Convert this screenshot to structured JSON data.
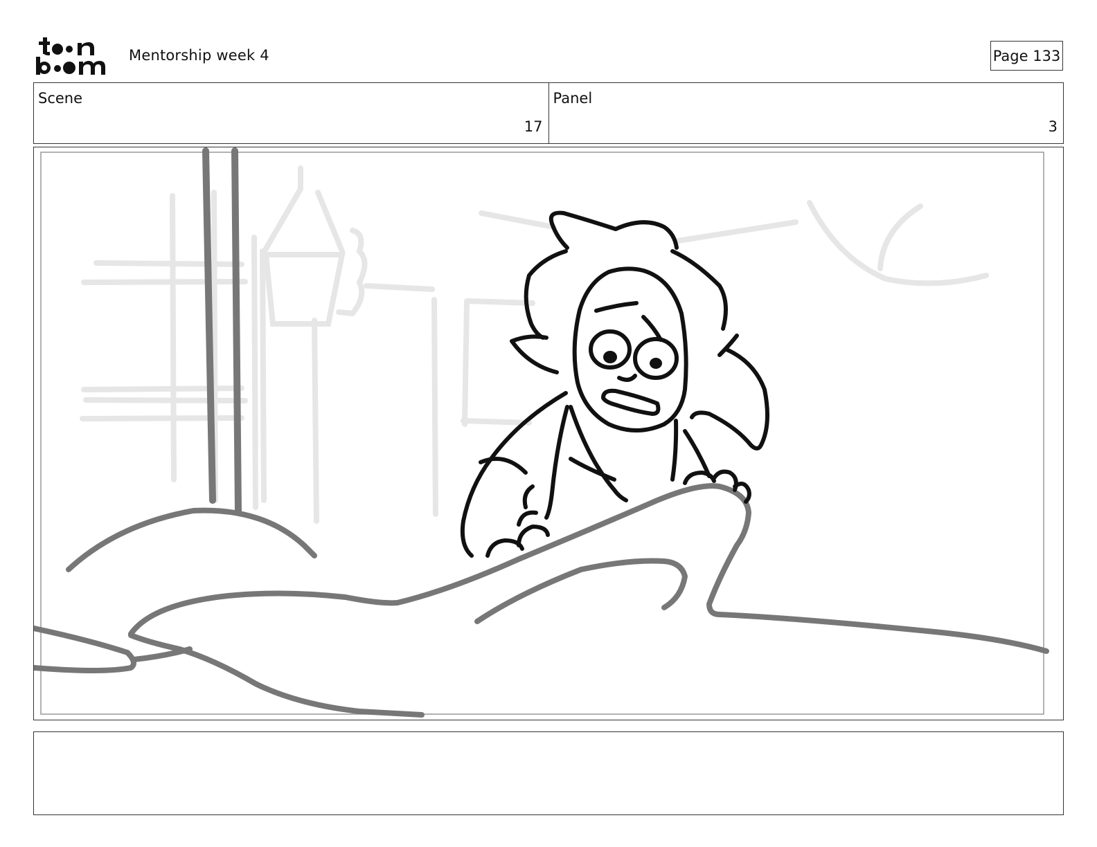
{
  "header": {
    "logo_text": "toon boom",
    "title": "Mentorship week 4",
    "page_label": "Page 133"
  },
  "info": {
    "scene_label": "Scene",
    "scene_value": "17",
    "panel_label": "Panel",
    "panel_value": "3"
  },
  "caption": {
    "text": ""
  },
  "colors": {
    "ink": "#111111",
    "mid_stroke": "#777777",
    "light_stroke": "#e6e6e6",
    "border": "#333333"
  }
}
